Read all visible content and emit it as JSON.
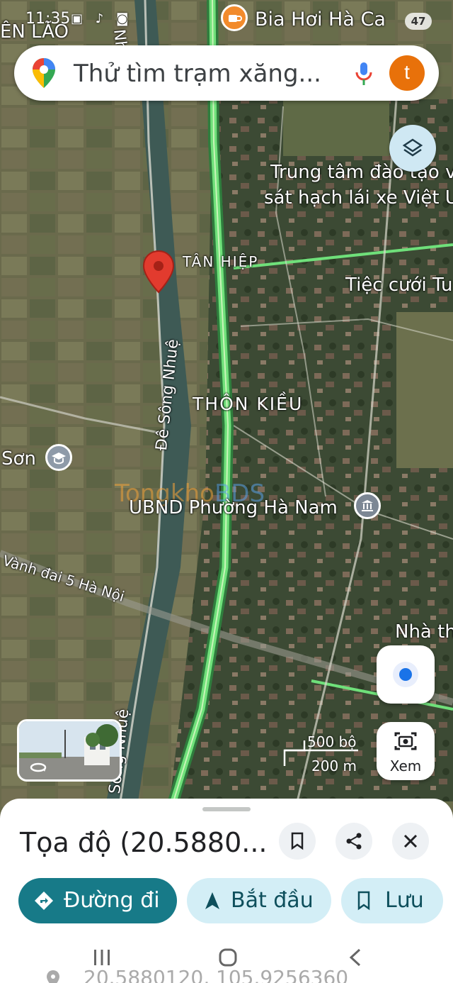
{
  "status_bar": {
    "time": "11:35",
    "battery": "47"
  },
  "search": {
    "placeholder": "Thử tìm trạm xăng...",
    "avatar_letter": "t"
  },
  "map": {
    "labels": {
      "en_lao": "ÊN LÃO",
      "bia_hoi": "Bia Hơi Hà Ca",
      "nhue_top": "Nhuệ",
      "trung_tam_1": "Trung tâm đào tạo v",
      "trung_tam_2": "sát hạch lái xe Việt U",
      "tan_hiep": "TÂN HIỆP",
      "tiec_cuoi": "Tiệc cưới Tu",
      "de_song_nhue": "Đê Sông Nhuệ",
      "thon_kieu": "THÔN KIỀU",
      "son": "Sơn",
      "watermark": "Tongkho",
      "watermark_suffix": "BDS",
      "ubnd": "UBND Phường Hà Nam",
      "vanh_dai": "Vành đai 5 Hà Nội",
      "nha_th": "Nhà th",
      "song_nhue_bottom": "Sông Nhuệ"
    }
  },
  "scale": {
    "top": "500 bộ",
    "bottom": "200 m"
  },
  "lens_label": "Xem",
  "place": {
    "title": "Tọa độ (20.5880...",
    "directions_label": "Đường đi",
    "start_label": "Bắt đầu",
    "save_label": "Lưu",
    "coords_full": "20.5880120, 105.9256360"
  },
  "colors": {
    "accent": "#0b7285",
    "teal_button": "#177a88",
    "pill_light": "#d3eef6",
    "pin_red": "#e23b2e",
    "road_green": "#6fe07a",
    "avatar_orange": "#e8710a"
  }
}
